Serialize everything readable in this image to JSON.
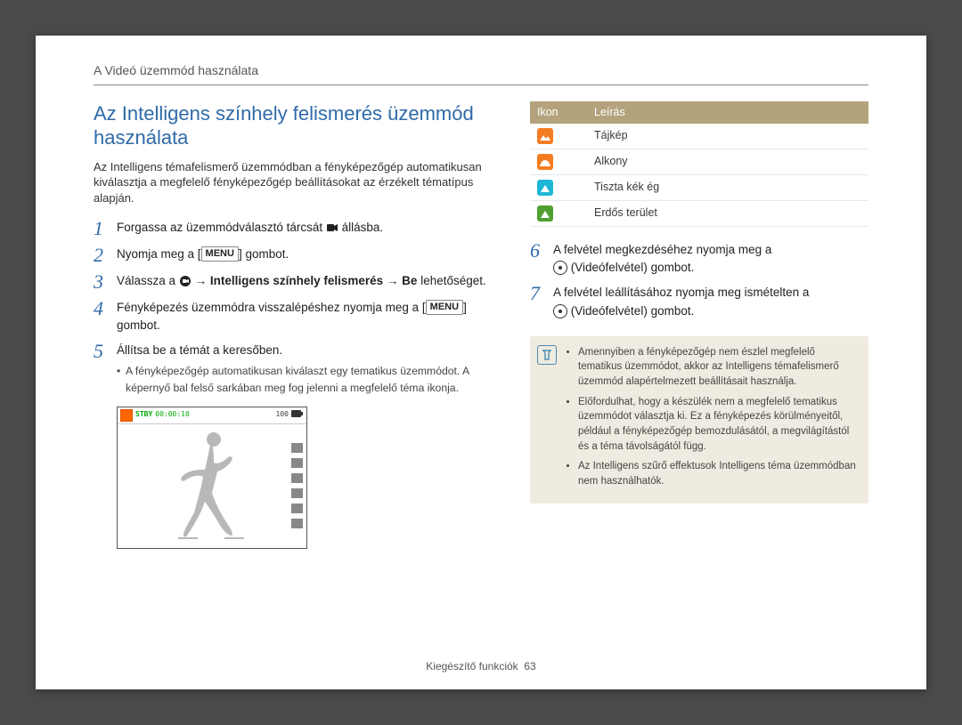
{
  "header": {
    "title": "A Videó üzemmód használata"
  },
  "section": {
    "title": "Az Intelligens színhely felismerés üzemmód használata",
    "intro": "Az Intelligens témafelismerő üzemmódban a fényképezőgép automatikusan kiválasztja a megfelelő fényképezőgép beállításokat az érzékelt tématípus alapján."
  },
  "steps_left": [
    {
      "n": "1",
      "pre": "Forgassa az üzemmódválasztó tárcsát ",
      "post": " állásba."
    },
    {
      "n": "2",
      "pre": "Nyomja meg a [",
      "mid": "MENU",
      "post": "] gombot."
    },
    {
      "n": "3",
      "pre": "Válassza a ",
      "mid": " → ",
      "bold": "Intelligens színhely felismerés",
      "post2": " → ",
      "bold2": "Be",
      "post3": " lehetőséget."
    },
    {
      "n": "4",
      "pre": "Fényképezés üzemmódra visszalépéshez nyomja meg a [",
      "mid": "MENU",
      "post": "] gombot."
    },
    {
      "n": "5",
      "pre": "Állítsa be a témát a keresőben."
    }
  ],
  "step5_bullet": "A fényképezőgép automatikusan kiválaszt egy tematikus üzemmódot. A képernyő bal felső sarkában meg fog jelenni a megfelelő téma ikonja.",
  "lcd": {
    "stby": "STBY",
    "time": "00:00:10",
    "batt": "100"
  },
  "table": {
    "head_icon": "Ikon",
    "head_desc": "Leírás",
    "rows": [
      {
        "label": "Tájkép"
      },
      {
        "label": "Alkony"
      },
      {
        "label": "Tiszta kék ég"
      },
      {
        "label": "Erdős terület"
      }
    ]
  },
  "steps_right": [
    {
      "n": "6",
      "text": "A felvétel megkezdéséhez nyomja meg a ",
      "post": " (Videófelvétel) gombot."
    },
    {
      "n": "7",
      "text": "A felvétel leállításához nyomja meg ismételten a ",
      "post": " (Videófelvétel) gombot."
    }
  ],
  "notes": [
    "Amennyiben a fényképezőgép nem észlel megfelelő tematikus üzemmódot, akkor az Intelligens témafelismerő üzemmód alapértelmezett beállításait használja.",
    "Előfordulhat, hogy a készülék nem a megfelelő tematikus üzemmódot választja ki. Ez a fényképezés körülményeitől, például a fényképezőgép bemozdulásától, a megvilágítástól és a téma távolságától függ.",
    "Az Intelligens szűrő effektusok Intelligens téma üzemmódban nem használhatók."
  ],
  "footer": {
    "section": "Kiegészítő funkciók",
    "page": "63"
  }
}
